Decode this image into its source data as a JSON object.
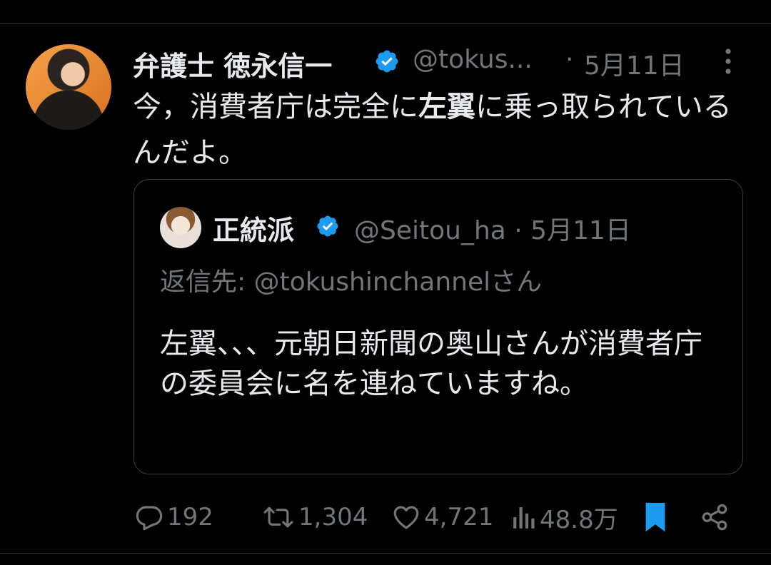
{
  "tweet": {
    "author_name": "弁護士 徳永信一",
    "handle": "@tokus...",
    "separator": "·",
    "date": "5月11日",
    "text_part1": "今，消費者庁は完全に",
    "text_bold": "左翼",
    "text_part2": "に乗っ取られているんだよ。"
  },
  "quote": {
    "author_name": "正統派",
    "handle_date": "@Seitou_ha · 5月11日",
    "replying_to": "返信先: @tokushinchannelさん",
    "text": "左翼、、、元朝日新聞の奥山さんが消費者庁の委員会に名を連ねていますね。"
  },
  "actions": {
    "replies": "192",
    "retweets": "1,304",
    "likes": "4,721",
    "views": "48.8万"
  },
  "colors": {
    "background": "#000000",
    "text": "#e7e9ea",
    "secondary": "#71767b",
    "verified": "#1d9bf0",
    "bookmark": "#1d9bf0"
  }
}
